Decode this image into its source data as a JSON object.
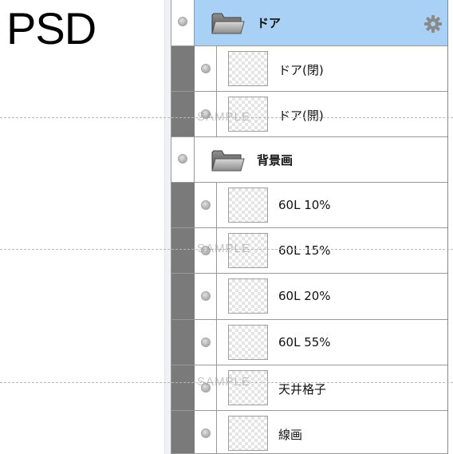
{
  "left_pane": {
    "format_label": "PSD"
  },
  "layers_panel": {
    "groups": [
      {
        "name": "ドア",
        "selected": true,
        "layers": [
          {
            "name": "ドア(閉)"
          },
          {
            "name": "ドア(開)"
          }
        ]
      },
      {
        "name": "背景画",
        "selected": false,
        "layers": [
          {
            "name": "60L 10%"
          },
          {
            "name": "60L 15%"
          },
          {
            "name": "60L 20%"
          },
          {
            "name": "60L 55%"
          },
          {
            "name": "天井格子"
          },
          {
            "name": "線画"
          }
        ]
      }
    ]
  },
  "watermark": {
    "text": "SAMPLE"
  },
  "colors": {
    "selection": "#a9d1f5",
    "indent_bar": "#7a7a7a",
    "border": "#9a9a9a"
  }
}
